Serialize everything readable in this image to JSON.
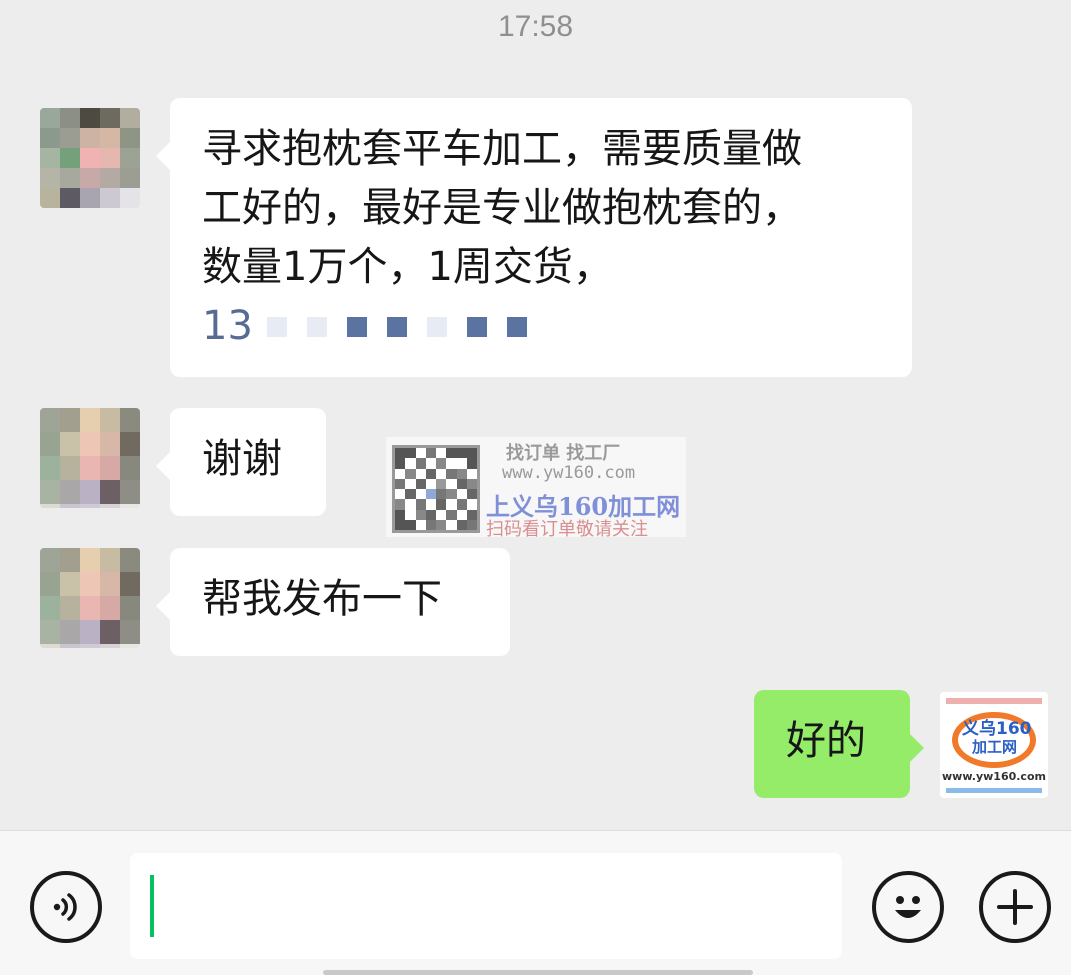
{
  "chat": {
    "timestamp": "17:58",
    "messages": [
      {
        "sender": "other",
        "lines": [
          "寻求抱枕套平车加工，需要质量做",
          "工好的，最好是专业做抱枕套的，",
          "数量1万个，1周交货，"
        ],
        "phone_prefix": "13"
      },
      {
        "sender": "other",
        "text": "谢谢"
      },
      {
        "sender": "other",
        "text": "帮我发布一下"
      },
      {
        "sender": "self",
        "text": "好的"
      }
    ]
  },
  "watermark": {
    "line1": "找订单 找工厂",
    "line2": "www.yw160.com",
    "line3": "上义乌160加工网",
    "line4": "扫码看订单敬请关注"
  },
  "self_avatar": {
    "line1": "义乌160",
    "line2": "加工网",
    "url": "www.yw160.com"
  },
  "input_bar": {
    "voice_icon": "voice-icon",
    "emoji_icon": "emoji-icon",
    "plus_icon": "plus-icon",
    "value": "",
    "accent": "#07c160"
  },
  "colors": {
    "background": "#ededed",
    "bubble_other": "#ffffff",
    "bubble_self": "#95ec69",
    "link": "#576b95"
  }
}
